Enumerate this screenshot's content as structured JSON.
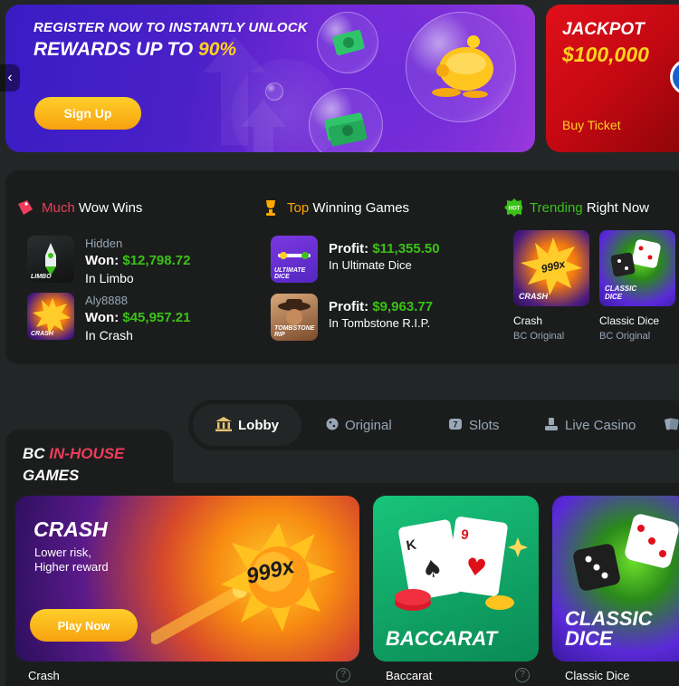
{
  "banner": {
    "line1": "REGISTER NOW TO INSTANTLY UNLOCK",
    "line2_prefix": "REWARDS UP TO ",
    "line2_highlight": "90%",
    "signup_label": "Sign Up",
    "prev_arrow": "‹"
  },
  "jackpot": {
    "title": "JACKPOT",
    "amount": "$100,000",
    "ticket_label": "Buy Ticket"
  },
  "stats": {
    "wow": {
      "title_accent": "Much",
      "title_rest": " Wow Wins",
      "items": [
        {
          "user": "Hidden",
          "won_prefix": "Won: ",
          "amount": "$12,798.72",
          "game": "In Limbo",
          "thumb_label": "LIMBO"
        },
        {
          "user": "Aly8888",
          "won_prefix": "Won: ",
          "amount": "$45,957.21",
          "game": "In Crash",
          "thumb_label": "CRASH"
        }
      ]
    },
    "top": {
      "title_accent": "Top",
      "title_rest": " Winning Games",
      "items": [
        {
          "profit_prefix": "Profit: ",
          "amount": "$11,355.50",
          "game": "In Ultimate Dice",
          "thumb_label": "ULTIMATE DICE"
        },
        {
          "profit_prefix": "Profit: ",
          "amount": "$9,963.77",
          "game": "In Tombstone R.I.P.",
          "thumb_label": "TOMBSTONE RIP"
        }
      ]
    },
    "trending": {
      "title_accent": "Trending",
      "title_rest": " Right Now",
      "badge": "HOT",
      "items": [
        {
          "name": "Crash",
          "sub": "BC Original",
          "art_label": "CRASH"
        },
        {
          "name": "Classic Dice",
          "sub": "BC Original",
          "art_label": "CLASSIC DICE"
        }
      ]
    }
  },
  "tabs": [
    {
      "label": "Lobby"
    },
    {
      "label": "Original"
    },
    {
      "label": "Slots"
    },
    {
      "label": "Live Casino"
    }
  ],
  "section": {
    "title_prefix": "BC ",
    "title_accent": "IN-HOUSE",
    "title_line2": "GAMES"
  },
  "cards": {
    "crash": {
      "title": "CRASH",
      "desc_line1": "Lower risk,",
      "desc_line2": "Higher reward",
      "play_label": "Play Now",
      "multiplier": "999x",
      "caption": "Crash"
    },
    "baccarat": {
      "art_label": "BACCARAT",
      "caption": "Baccarat"
    },
    "dice": {
      "art_line1": "CLASSIC",
      "art_line2": "DICE",
      "caption": "Classic Dice"
    }
  },
  "help_glyph": "?"
}
